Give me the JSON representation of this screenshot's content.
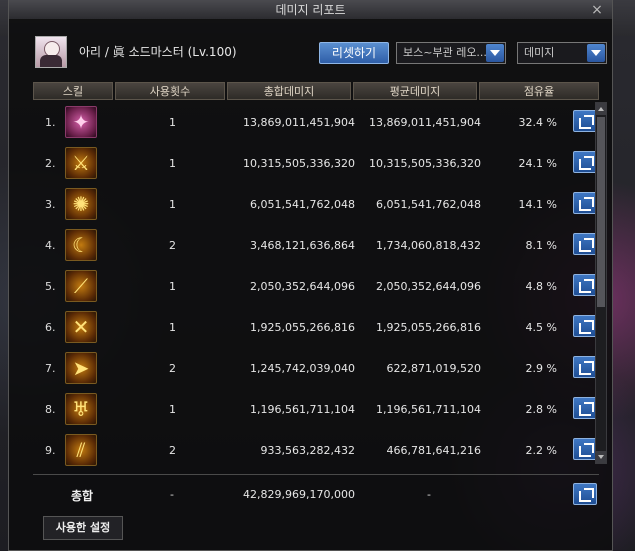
{
  "window": {
    "title": "데미지 리포트",
    "close_label": "×"
  },
  "character": {
    "name": "아리 / 眞 소드마스터 (Lv.100)"
  },
  "controls": {
    "reset_label": "리셋하기",
    "mode_dropdown": "보스~부관 레오...",
    "metric_dropdown": "데미지"
  },
  "table": {
    "headers": {
      "skill": "스킬",
      "uses": "사용횟수",
      "total": "총합데미지",
      "avg": "평균데미지",
      "share": "점유율"
    },
    "rows": [
      {
        "rank": "1.",
        "icon": "skill-icon-1",
        "uses": "1",
        "total": "13,869,011,451,904",
        "avg": "13,869,011,451,904",
        "share": "32.4 %"
      },
      {
        "rank": "2.",
        "icon": "skill-icon-2",
        "uses": "1",
        "total": "10,315,505,336,320",
        "avg": "10,315,505,336,320",
        "share": "24.1 %"
      },
      {
        "rank": "3.",
        "icon": "skill-icon-3",
        "uses": "1",
        "total": "6,051,541,762,048",
        "avg": "6,051,541,762,048",
        "share": "14.1 %"
      },
      {
        "rank": "4.",
        "icon": "skill-icon-4",
        "uses": "2",
        "total": "3,468,121,636,864",
        "avg": "1,734,060,818,432",
        "share": "8.1 %"
      },
      {
        "rank": "5.",
        "icon": "skill-icon-5",
        "uses": "1",
        "total": "2,050,352,644,096",
        "avg": "2,050,352,644,096",
        "share": "4.8 %"
      },
      {
        "rank": "6.",
        "icon": "skill-icon-6",
        "uses": "1",
        "total": "1,925,055,266,816",
        "avg": "1,925,055,266,816",
        "share": "4.5 %"
      },
      {
        "rank": "7.",
        "icon": "skill-icon-7",
        "uses": "2",
        "total": "1,245,742,039,040",
        "avg": "622,871,019,520",
        "share": "2.9 %"
      },
      {
        "rank": "8.",
        "icon": "skill-icon-8",
        "uses": "1",
        "total": "1,196,561,711,104",
        "avg": "1,196,561,711,104",
        "share": "2.8 %"
      },
      {
        "rank": "9.",
        "icon": "skill-icon-9",
        "uses": "2",
        "total": "933,563,282,432",
        "avg": "466,781,641,216",
        "share": "2.2 %"
      }
    ]
  },
  "total": {
    "label": "총합",
    "uses": "-",
    "sum": "42,829,969,170,000",
    "avg": "-"
  },
  "settings_tab": {
    "label": "사용한 설정"
  }
}
